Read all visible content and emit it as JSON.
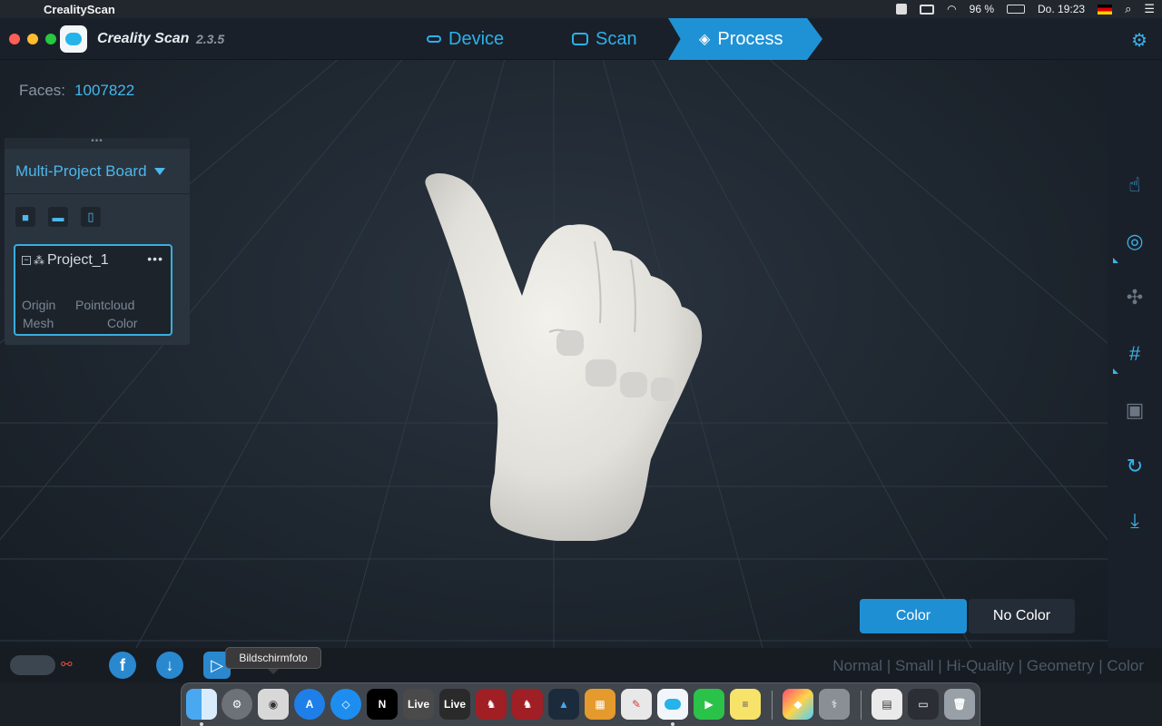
{
  "menubar": {
    "app_name": "CrealityScan",
    "battery": "96 %",
    "datetime": "Do. 19:23"
  },
  "app": {
    "title": "Creality Scan",
    "version": "2.3.5",
    "nav": {
      "device": "Device",
      "scan": "Scan",
      "process": "Process",
      "active": "Process"
    }
  },
  "viewport": {
    "faces_label": "Faces:",
    "faces_value": "1007822"
  },
  "board": {
    "title": "Multi-Project Board",
    "project": {
      "name": "Project_1",
      "items": [
        "Origin",
        "Pointcloud",
        "Mesh",
        "Color"
      ]
    }
  },
  "color_toggle": {
    "color": "Color",
    "no_color": "No Color",
    "selected": "Color"
  },
  "modes": {
    "items": [
      "Normal",
      "Small",
      "Hi-Quality",
      "Geometry",
      "Color"
    ]
  },
  "tooltip": "Bildschirmfoto",
  "dock": {
    "live_label_1": "Live",
    "live_label_2": "Live"
  },
  "colors": {
    "accent": "#1f92d6",
    "accent_light": "#3ab3ec",
    "background": "#1c232c",
    "link_broken": "#e0473d"
  }
}
